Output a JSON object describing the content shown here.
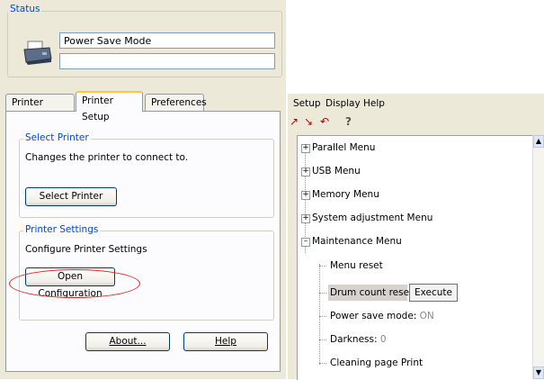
{
  "left": {
    "status_label": "Status",
    "status_line1": "Power Save Mode",
    "status_line2": "",
    "tabs": [
      {
        "label": "Printer State"
      },
      {
        "label": "Printer Setup"
      },
      {
        "label": "Preferences"
      }
    ],
    "select_printer": {
      "title": "Select Printer",
      "desc": "Changes the printer to connect to.",
      "button": "Select Printer"
    },
    "printer_settings": {
      "title": "Printer Settings",
      "desc": "Configure Printer Settings",
      "button": "Open Configuration"
    },
    "about_button": "About...",
    "help_button": "Help"
  },
  "right": {
    "menus": [
      "Setup",
      "Display",
      "Help"
    ],
    "toolbar_icons": [
      "export-icon",
      "import-icon",
      "undo-icon",
      "help-icon"
    ],
    "tree": {
      "parallel": "Parallel Menu",
      "usb": "USB Menu",
      "memory": "Memory Menu",
      "system": "System adjustment Menu",
      "maintenance": "Maintenance Menu",
      "menu_reset": "Menu reset",
      "drum_reset": "Drum count reset",
      "execute": "Execute",
      "power_save_label": "Power save mode:",
      "power_save_value": "ON",
      "darkness_label": "Darkness:",
      "darkness_value": "0",
      "cleaning": "Cleaning page Print"
    }
  },
  "colors": {
    "dialog_bg": "#ece9d8",
    "group_title": "#0046d5",
    "highlight_ellipse": "#dd2222",
    "active_tab_accent": "#ffc83c"
  }
}
